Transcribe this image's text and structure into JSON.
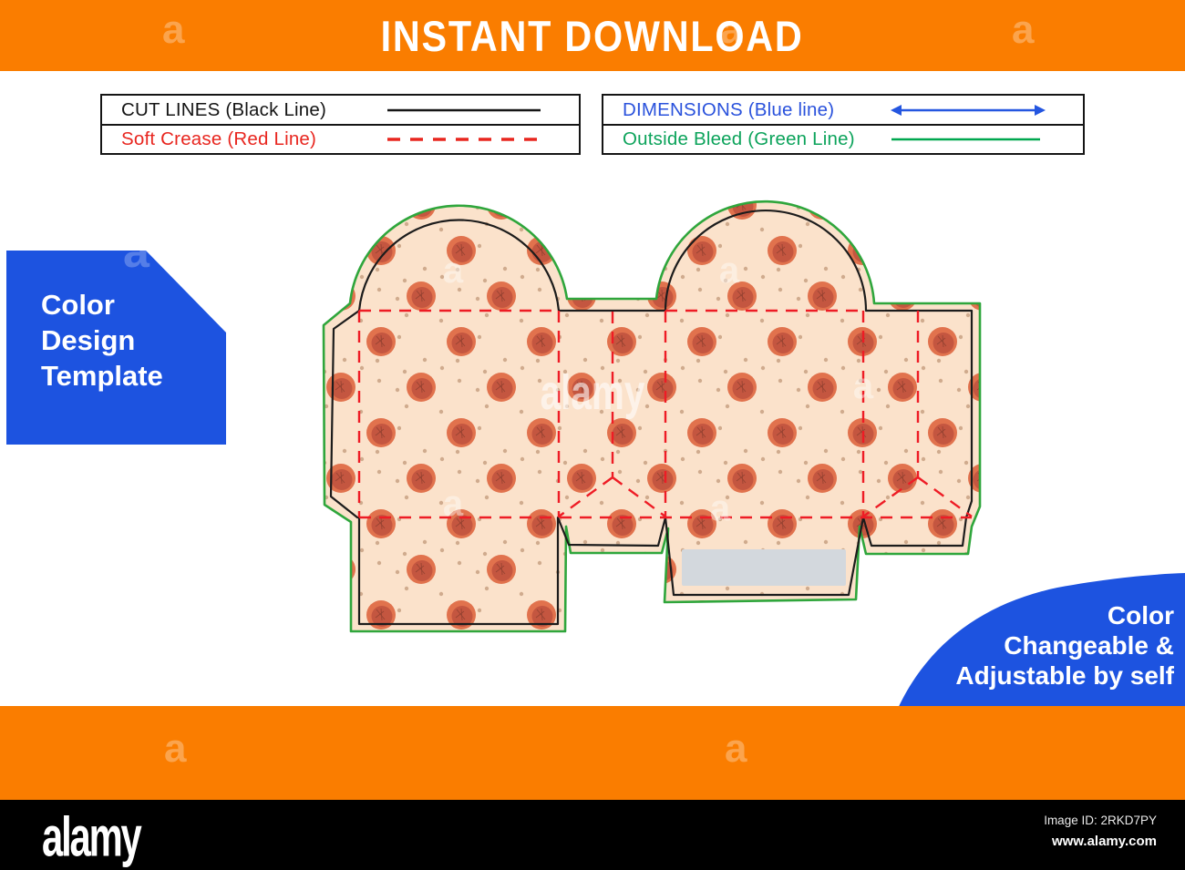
{
  "top_banner": {
    "text": "INSTANT DOWNLOAD",
    "bg_color": "#FA7D00",
    "text_color": "#FFFFFF"
  },
  "legend_left": {
    "rows": [
      {
        "label": "CUT LINES (Black Line)",
        "color": "#151515",
        "line_style": "solid"
      },
      {
        "label": "Soft Crease (Red Line)",
        "color": "#E8261F",
        "line_style": "dashed"
      }
    ]
  },
  "legend_right": {
    "rows": [
      {
        "label": "DIMENSIONS (Blue line)",
        "color": "#2A52DC",
        "line_color": "#2456E0",
        "line_style": "double-arrow"
      },
      {
        "label": "Outside Bleed (Green Line)",
        "color": "#0CA35B",
        "line_color": "#00A74F",
        "line_style": "solid"
      }
    ]
  },
  "left_badge": {
    "lines": [
      "Color",
      "Design",
      "Template"
    ],
    "bg_color": "#1D53E0"
  },
  "right_badge": {
    "lines": [
      "Color",
      "Changeable &",
      "Adjustable by self"
    ],
    "bg_color": "#1D53E0"
  },
  "bottom_banner": {
    "bg_color": "#FA7D00"
  },
  "footer": {
    "logo_text": "alamy",
    "image_id": "Image ID: 2RKD7PY",
    "website": "www.alamy.com",
    "bg_color": "#000000"
  },
  "watermarks": {
    "word": "alamy",
    "letter": "a"
  },
  "dieline": {
    "colors": {
      "cut": "#1C1C1C",
      "crease": "#EE1C25",
      "bleed": "#2FA63C",
      "panel_bg": "#FBE2CB",
      "dot_outer": "#E1724D",
      "dot_inner": "#C2543F",
      "dot_detail": "#8C3D2D",
      "speck": "#C9A183",
      "glue_area": "#D3D8DD"
    }
  }
}
